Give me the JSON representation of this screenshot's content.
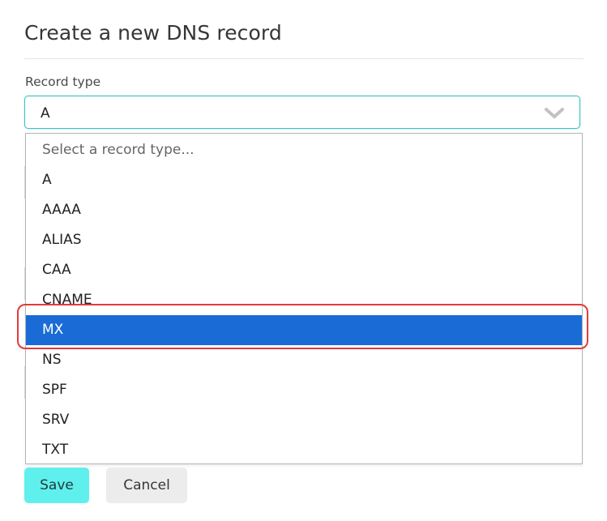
{
  "form": {
    "title": "Create a new DNS record",
    "record_type_label": "Record type",
    "selected_value": "A"
  },
  "dropdown": {
    "options": [
      "Select a record type...",
      "A",
      "AAAA",
      "ALIAS",
      "CAA",
      "CNAME",
      "MX",
      "NS",
      "SPF",
      "SRV",
      "TXT"
    ],
    "highlighted": "MX"
  },
  "actions": {
    "save_label": "Save",
    "cancel_label": "Cancel"
  },
  "colors": {
    "focus_border": "#3cc4c8",
    "highlight_bg": "#1a6bd6",
    "annotation_ring": "#e23b3b",
    "save_bg": "#5ff0ee"
  }
}
